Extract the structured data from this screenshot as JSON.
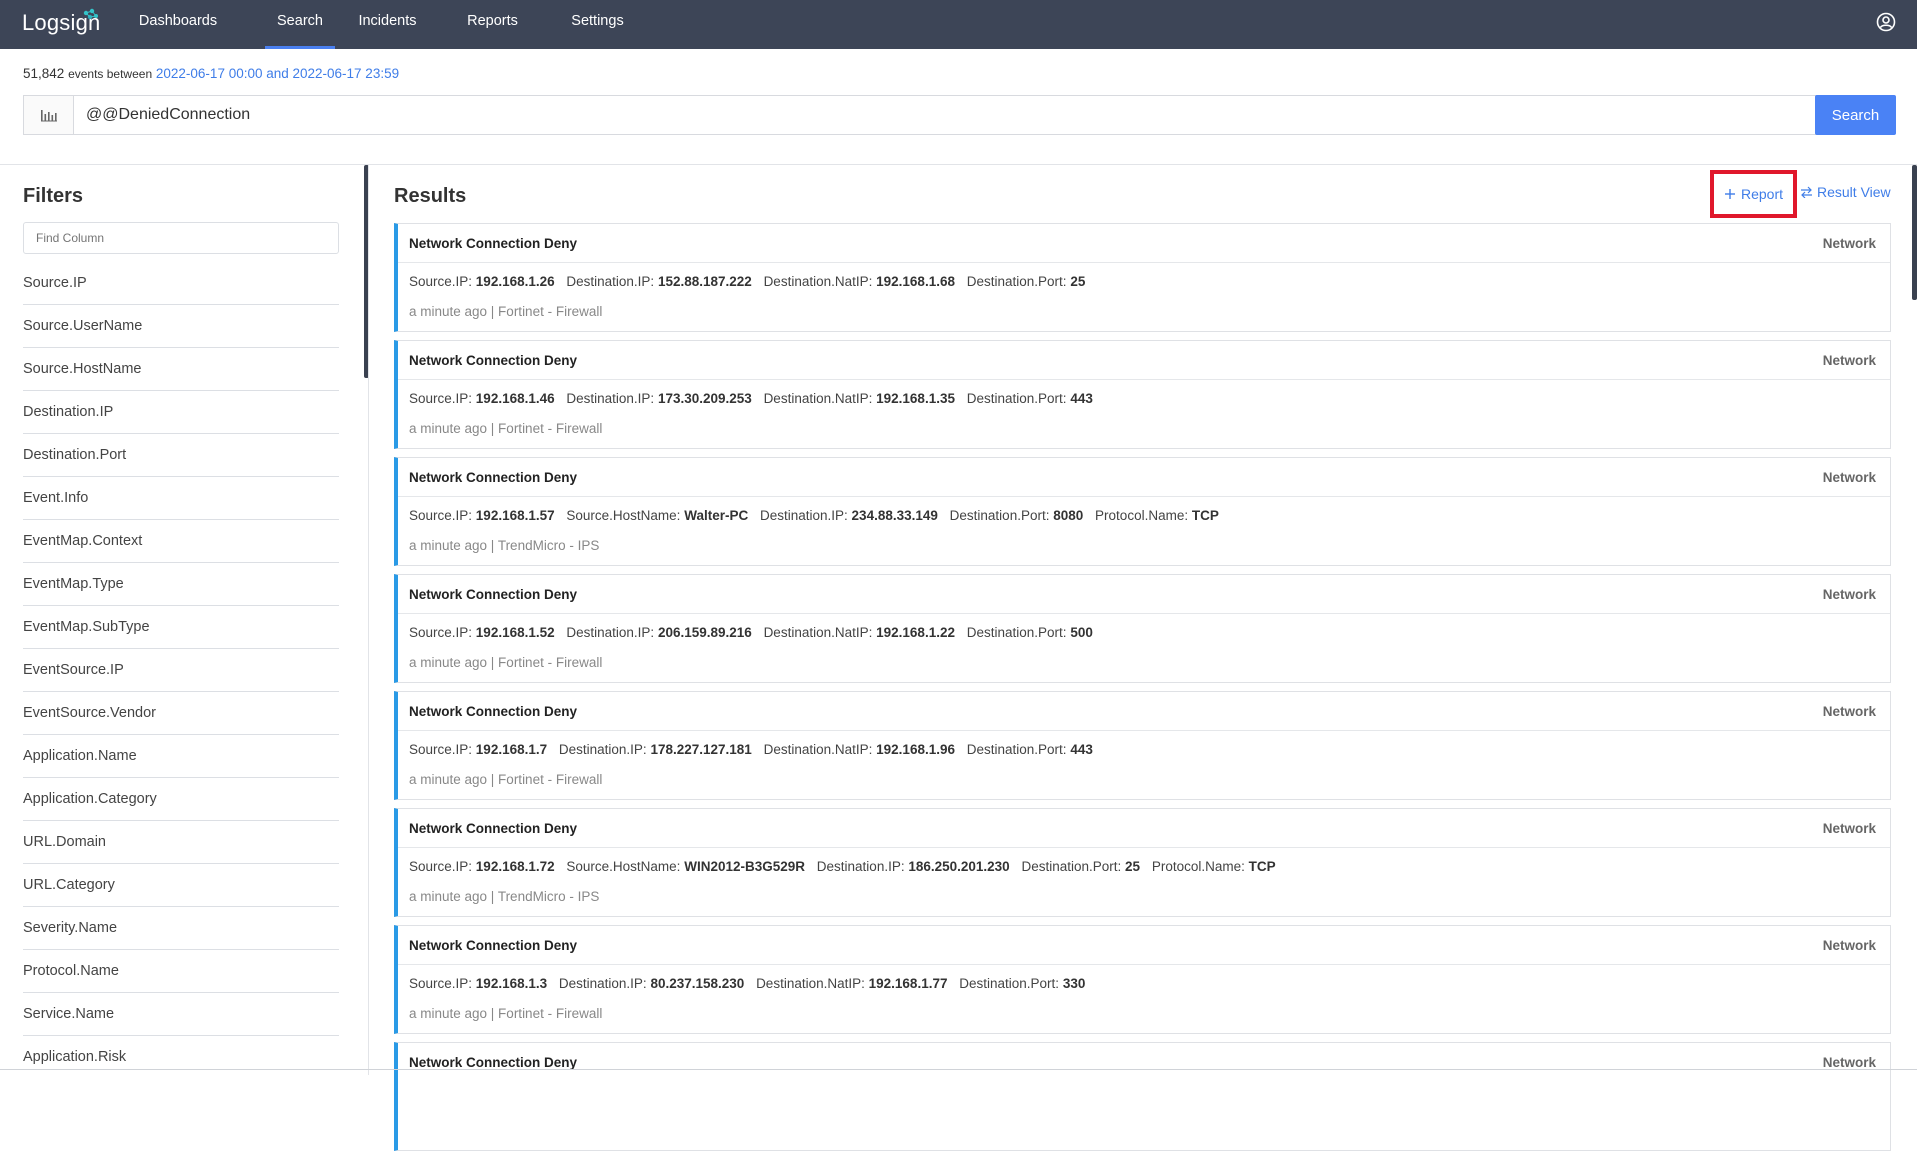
{
  "app": {
    "logo_text": "Logsign"
  },
  "nav": {
    "items": [
      {
        "label": "Dashboards"
      },
      {
        "label": "Search"
      },
      {
        "label": "Incidents"
      },
      {
        "label": "Reports"
      },
      {
        "label": "Settings"
      }
    ],
    "active": "Search"
  },
  "search": {
    "event_count": "51,842",
    "events_between_text": "events between",
    "date_range": "2022-06-17 00:00 and 2022-06-17 23:59",
    "query": "@@DeniedConnection",
    "button_label": "Search"
  },
  "filters": {
    "title": "Filters",
    "find_placeholder": "Find Column",
    "items": [
      "Source.IP",
      "Source.UserName",
      "Source.HostName",
      "Destination.IP",
      "Destination.Port",
      "Event.Info",
      "EventMap.Context",
      "EventMap.Type",
      "EventMap.SubType",
      "EventSource.IP",
      "EventSource.Vendor",
      "Application.Name",
      "Application.Category",
      "URL.Domain",
      "URL.Category",
      "Severity.Name",
      "Protocol.Name",
      "Service.Name",
      "Application.Risk"
    ]
  },
  "results": {
    "title": "Results",
    "report_label": "Report",
    "result_view_label": "Result View",
    "cards": [
      {
        "title": "Network Connection Deny",
        "category": "Network",
        "fields": [
          {
            "key": "Source.IP:",
            "value": "192.168.1.26"
          },
          {
            "key": "Destination.IP:",
            "value": "152.88.187.222"
          },
          {
            "key": "Destination.NatIP:",
            "value": "192.168.1.68"
          },
          {
            "key": "Destination.Port:",
            "value": "25"
          }
        ],
        "meta": "a minute ago | Fortinet - Firewall"
      },
      {
        "title": "Network Connection Deny",
        "category": "Network",
        "fields": [
          {
            "key": "Source.IP:",
            "value": "192.168.1.46"
          },
          {
            "key": "Destination.IP:",
            "value": "173.30.209.253"
          },
          {
            "key": "Destination.NatIP:",
            "value": "192.168.1.35"
          },
          {
            "key": "Destination.Port:",
            "value": "443"
          }
        ],
        "meta": "a minute ago | Fortinet - Firewall"
      },
      {
        "title": "Network Connection Deny",
        "category": "Network",
        "fields": [
          {
            "key": "Source.IP:",
            "value": "192.168.1.57"
          },
          {
            "key": "Source.HostName:",
            "value": "Walter-PC"
          },
          {
            "key": "Destination.IP:",
            "value": "234.88.33.149"
          },
          {
            "key": "Destination.Port:",
            "value": "8080"
          },
          {
            "key": "Protocol.Name:",
            "value": "TCP"
          }
        ],
        "meta": "a minute ago | TrendMicro - IPS"
      },
      {
        "title": "Network Connection Deny",
        "category": "Network",
        "fields": [
          {
            "key": "Source.IP:",
            "value": "192.168.1.52"
          },
          {
            "key": "Destination.IP:",
            "value": "206.159.89.216"
          },
          {
            "key": "Destination.NatIP:",
            "value": "192.168.1.22"
          },
          {
            "key": "Destination.Port:",
            "value": "500"
          }
        ],
        "meta": "a minute ago | Fortinet - Firewall"
      },
      {
        "title": "Network Connection Deny",
        "category": "Network",
        "fields": [
          {
            "key": "Source.IP:",
            "value": "192.168.1.7"
          },
          {
            "key": "Destination.IP:",
            "value": "178.227.127.181"
          },
          {
            "key": "Destination.NatIP:",
            "value": "192.168.1.96"
          },
          {
            "key": "Destination.Port:",
            "value": "443"
          }
        ],
        "meta": "a minute ago | Fortinet - Firewall"
      },
      {
        "title": "Network Connection Deny",
        "category": "Network",
        "fields": [
          {
            "key": "Source.IP:",
            "value": "192.168.1.72"
          },
          {
            "key": "Source.HostName:",
            "value": "WIN2012-B3G529R"
          },
          {
            "key": "Destination.IP:",
            "value": "186.250.201.230"
          },
          {
            "key": "Destination.Port:",
            "value": "25"
          },
          {
            "key": "Protocol.Name:",
            "value": "TCP"
          }
        ],
        "meta": "a minute ago | TrendMicro - IPS"
      },
      {
        "title": "Network Connection Deny",
        "category": "Network",
        "fields": [
          {
            "key": "Source.IP:",
            "value": "192.168.1.3"
          },
          {
            "key": "Destination.IP:",
            "value": "80.237.158.230"
          },
          {
            "key": "Destination.NatIP:",
            "value": "192.168.1.77"
          },
          {
            "key": "Destination.Port:",
            "value": "330"
          }
        ],
        "meta": "a minute ago | Fortinet - Firewall"
      },
      {
        "title": "Network Connection Deny",
        "category": "Network",
        "fields": [],
        "meta": ""
      }
    ]
  },
  "colors": {
    "topbar_bg": "#3d4557",
    "accent": "#4a82f5",
    "link": "#3f7de8",
    "card_accent": "#2a9ae6",
    "highlight_box": "#e0172b"
  }
}
